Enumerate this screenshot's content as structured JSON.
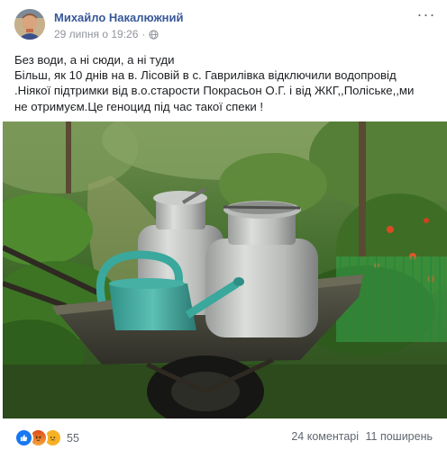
{
  "post": {
    "author": "Михайло Накалюжний",
    "timestamp": "29 липня о 19:26",
    "privacy_icon": "globe-icon",
    "more_icon": "more-options-icon",
    "text_lines": [
      "Без води, а ні сюди, а ні туди",
      "Більш, як 10 днів на в. Лісовій в с. Гаврилівка відключили водопровід",
      ".Ніякої підтримки від в.о.старости Покрасьон О.Г. і від ЖКГ,,Поліське,,ми",
      "не отримуєм.Це геноцид під час такої спеки !"
    ]
  },
  "footer": {
    "reaction_icons": [
      "like-icon",
      "angry-icon",
      "sad-icon"
    ],
    "reaction_count": "55",
    "comments": "24 коментарі",
    "shares": "11 поширень"
  },
  "colors": {
    "link": "#385898",
    "text": "#1c1e21",
    "secondary": "#90949c",
    "like": "#1877f2",
    "angry": "#e9710f",
    "sad": "#f7b125"
  }
}
